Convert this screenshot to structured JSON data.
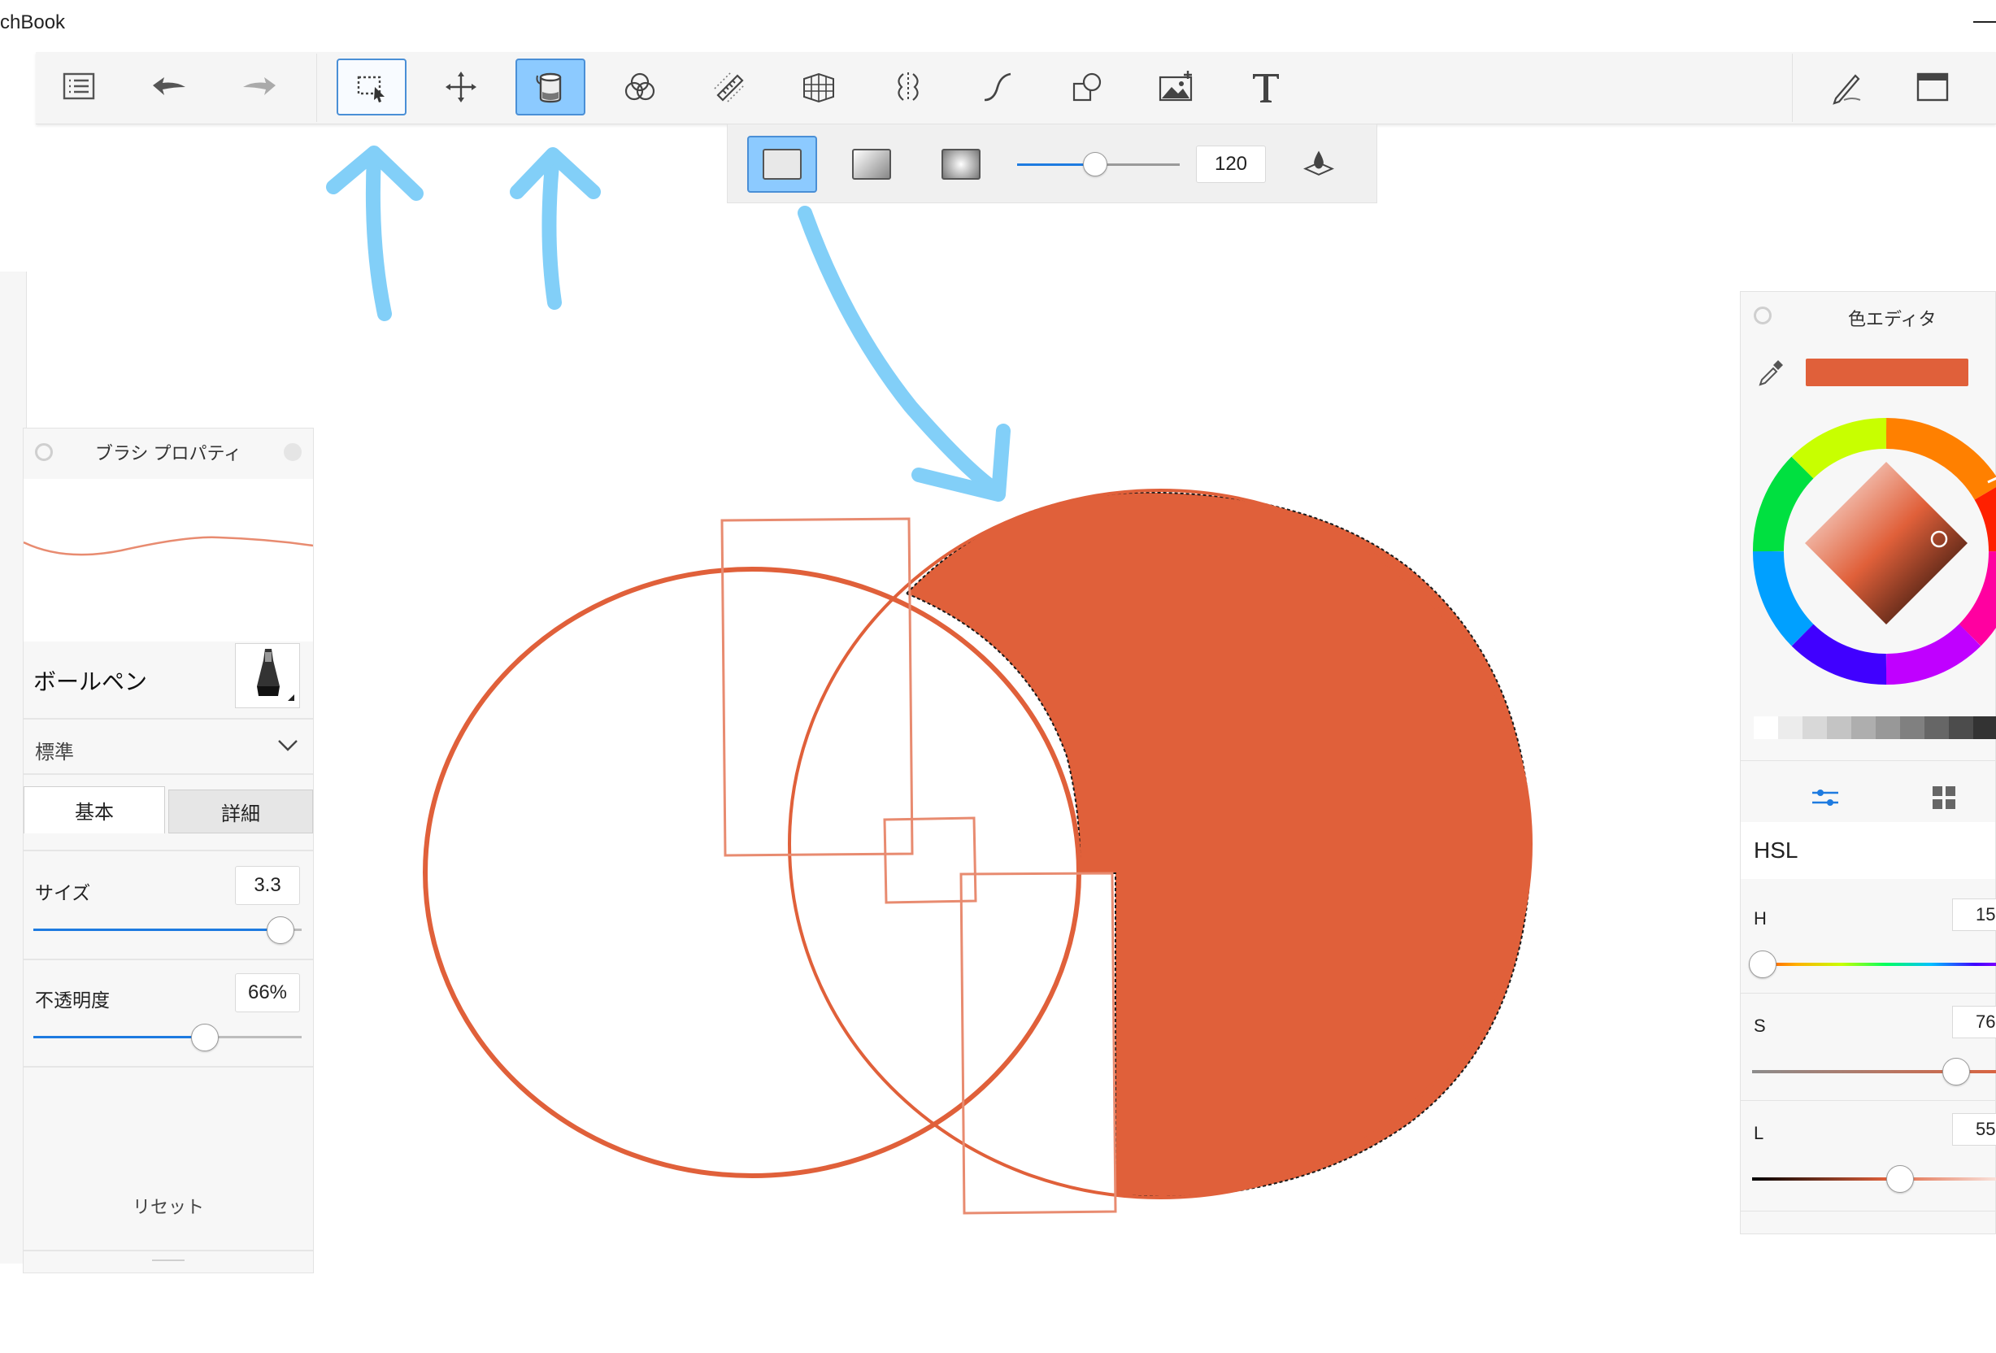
{
  "window": {
    "title": "chBook"
  },
  "toolbar": {
    "items": [
      {
        "name": "layer-list-icon"
      },
      {
        "name": "undo-icon"
      },
      {
        "name": "redo-icon"
      },
      {
        "name": "selection-icon",
        "state": "outlined"
      },
      {
        "name": "transform-move-icon"
      },
      {
        "name": "fill-bucket-icon",
        "state": "active"
      },
      {
        "name": "color-blend-icon"
      },
      {
        "name": "ruler-icon"
      },
      {
        "name": "perspective-grid-icon"
      },
      {
        "name": "symmetry-icon"
      },
      {
        "name": "stroke-curve-icon"
      },
      {
        "name": "shapes-icon"
      },
      {
        "name": "add-image-icon"
      },
      {
        "name": "text-icon"
      },
      {
        "name": "pen-icon"
      },
      {
        "name": "window-icon"
      }
    ]
  },
  "fill_options": {
    "modes": [
      "solid-fill",
      "linear-gradient",
      "radial-gradient"
    ],
    "selected": "solid-fill",
    "tolerance_value": "120",
    "tolerance_fraction": 0.48
  },
  "brush_panel": {
    "title": "ブラシ プロパティ",
    "brush_name": "ボールペン",
    "preset": "標準",
    "tabs": [
      "基本",
      "詳細"
    ],
    "active_tab": "基本",
    "size_label": "サイズ",
    "size_value": "3.3",
    "size_fraction": 0.92,
    "opacity_label": "不透明度",
    "opacity_value": "66%",
    "opacity_fraction": 0.64,
    "reset_label": "リセット"
  },
  "color_panel": {
    "title": "色エディタ",
    "current_color": "#e0603a",
    "mode": "HSL",
    "h_label": "H",
    "h_value": "15",
    "h_fraction": 0.04,
    "s_label": "S",
    "s_value": "76",
    "s_fraction": 0.76,
    "l_label": "L",
    "l_value": "55",
    "l_fraction": 0.55,
    "gray_swatches": [
      "#ffffff",
      "#ececec",
      "#d8d8d8",
      "#c4c4c4",
      "#aeaeae",
      "#989898",
      "#808080",
      "#666666",
      "#4c4c4c",
      "#333333",
      "#1a1a1a"
    ]
  },
  "colors": {
    "accent_blue": "#1e7be0",
    "selected_fill": "#8ccaff",
    "annotation_arrow": "#82cff8",
    "shape_color": "#e0603a"
  }
}
